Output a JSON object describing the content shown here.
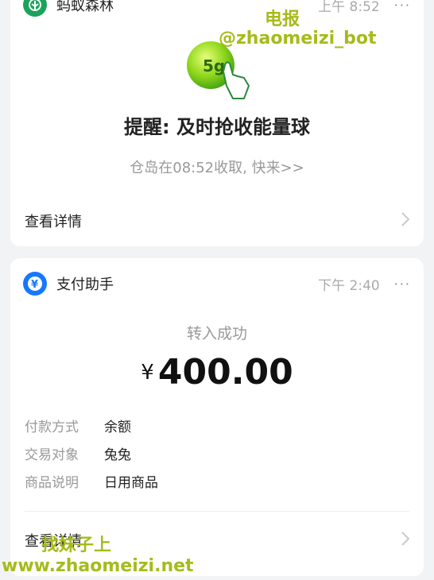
{
  "card1": {
    "app_name": "蚂蚁森林",
    "time": "上午 8:52",
    "more": "···",
    "badge_text": "5g",
    "title": "提醒: 及时抢收能量球",
    "subtitle": "仓岛在08:52收取, 快来>>",
    "footer_label": "查看详情",
    "accent": "#1aa35a"
  },
  "card2": {
    "app_name": "支付助手",
    "time": "下午 2:40",
    "more": "···",
    "status": "转入成功",
    "currency": "¥",
    "amount": "400.00",
    "details": [
      {
        "key": "付款方式",
        "value": "余额"
      },
      {
        "key": "交易对象",
        "value": "兔兔"
      },
      {
        "key": "商品说明",
        "value": "日用商品"
      }
    ],
    "footer_label": "查看详情",
    "accent": "#1677ff"
  },
  "watermark": {
    "line1": "电报",
    "line2": "@zhaomeizi_bot",
    "line3": "找妹子上",
    "line4": "www.zhaomeizi.net"
  }
}
